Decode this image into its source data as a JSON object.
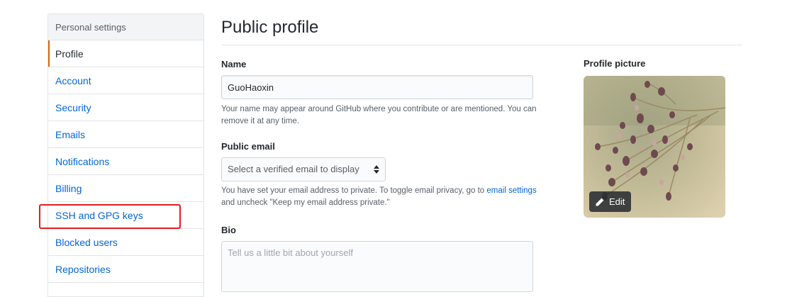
{
  "sidebar": {
    "header": "Personal settings",
    "items": [
      {
        "label": "Profile"
      },
      {
        "label": "Account"
      },
      {
        "label": "Security"
      },
      {
        "label": "Emails"
      },
      {
        "label": "Notifications"
      },
      {
        "label": "Billing"
      },
      {
        "label": "SSH and GPG keys"
      },
      {
        "label": "Blocked users"
      },
      {
        "label": "Repositories"
      }
    ]
  },
  "main": {
    "title": "Public profile",
    "name": {
      "label": "Name",
      "value": "GuoHaoxin",
      "note": "Your name may appear around GitHub where you contribute or are mentioned. You can remove it at any time."
    },
    "public_email": {
      "label": "Public email",
      "selected": "Select a verified email to display",
      "note_prefix": "You have set your email address to private. To toggle email privacy, go to ",
      "note_link": "email settings",
      "note_suffix": "and uncheck \"Keep my email address private.\""
    },
    "bio": {
      "label": "Bio",
      "placeholder": "Tell us a little bit about yourself"
    }
  },
  "profile_picture": {
    "label": "Profile picture",
    "edit_label": "Edit",
    "edit_icon": "pencil-icon"
  },
  "colors": {
    "link": "#0366d6",
    "selected_indicator": "#e36209",
    "highlight": "#e01e1e"
  }
}
